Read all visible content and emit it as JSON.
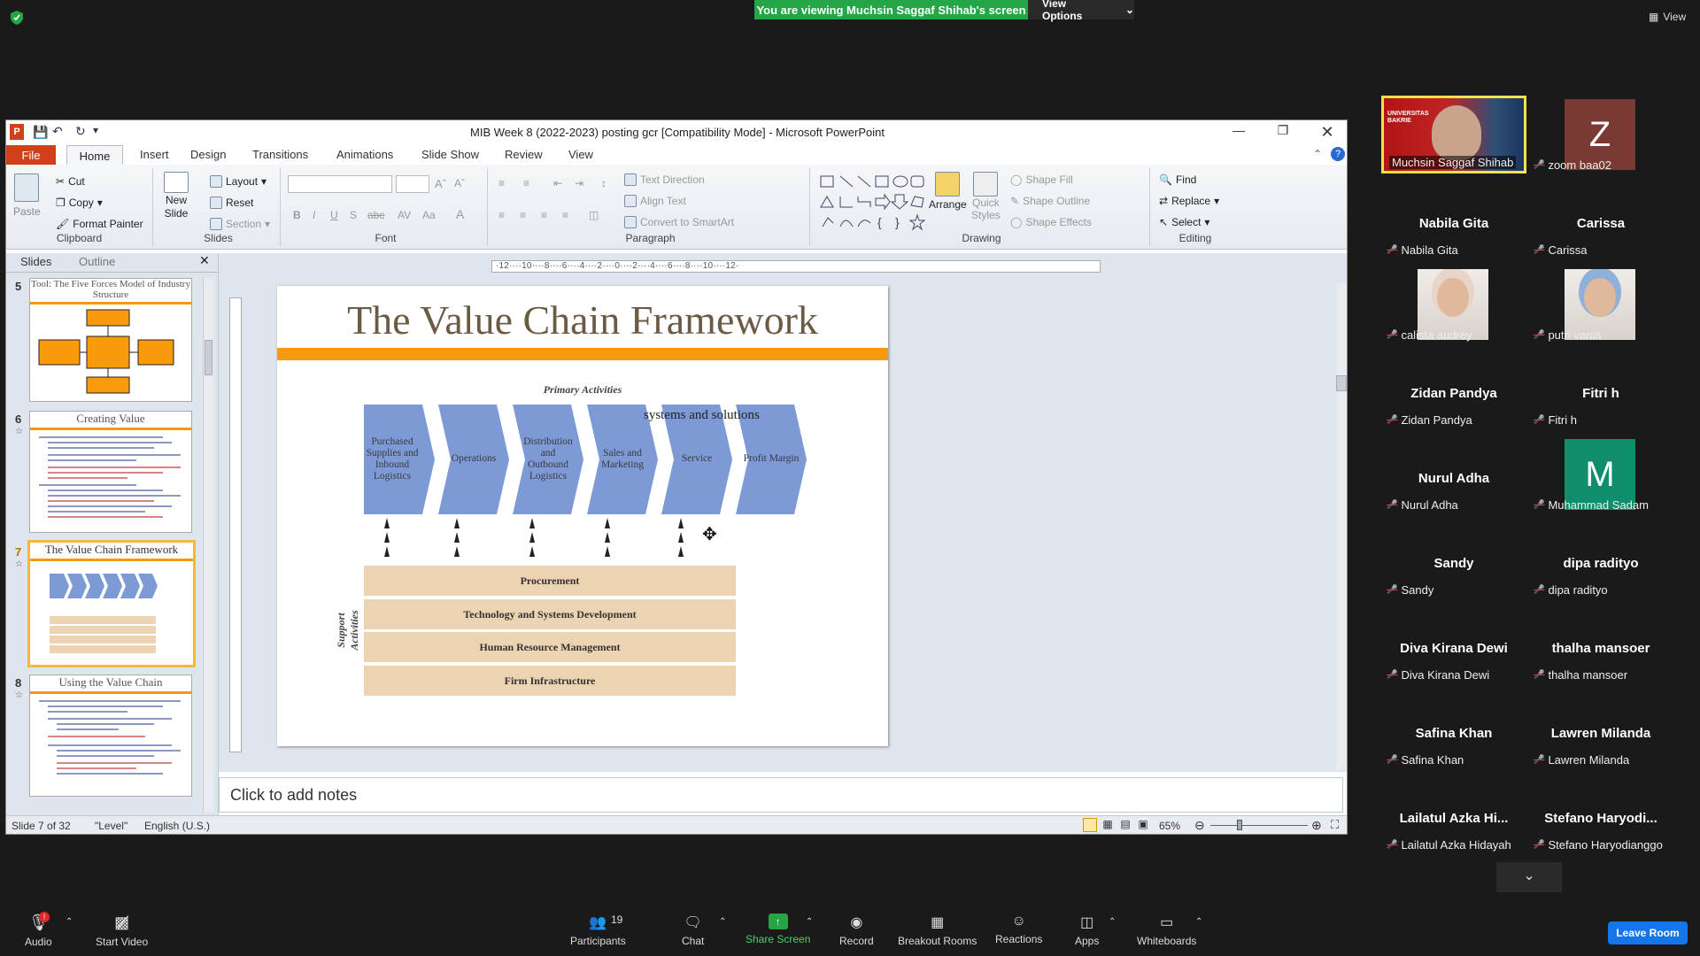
{
  "zoom": {
    "banner": "You are viewing Muchsin Saggaf Shihab's screen",
    "view_options": "View Options",
    "view": "View",
    "toolbar": {
      "audio": "Audio",
      "start_video": "Start Video",
      "participants": "Participants",
      "participants_count": "19",
      "chat": "Chat",
      "share_screen": "Share Screen",
      "record": "Record",
      "breakout": "Breakout Rooms",
      "reactions": "Reactions",
      "apps": "Apps",
      "whiteboards": "Whiteboards",
      "leave": "Leave Room"
    },
    "participants": [
      {
        "display": "",
        "label": "Muchsin Saggaf Shihab",
        "type": "video",
        "photo_caption": "UNIVERSITAS BAKRIE"
      },
      {
        "display": "Z",
        "label": "zoom baa02",
        "type": "avatar",
        "color": "#7a3a34"
      },
      {
        "display": "Nabila Gita",
        "label": "Nabila Gita",
        "type": "name"
      },
      {
        "display": "Carissa",
        "label": "Carissa",
        "type": "name"
      },
      {
        "display": "",
        "label": "calista audrey",
        "type": "photo"
      },
      {
        "display": "",
        "label": "putri vania",
        "type": "photo"
      },
      {
        "display": "Zidan Pandya",
        "label": "Zidan Pandya",
        "type": "name"
      },
      {
        "display": "Fitri h",
        "label": "Fitri h",
        "type": "name"
      },
      {
        "display": "Nurul Adha",
        "label": "Nurul Adha",
        "type": "name"
      },
      {
        "display": "M",
        "label": "Muhammad Sadam",
        "type": "avatar",
        "color": "#0e8e6a"
      },
      {
        "display": "Sandy",
        "label": "Sandy",
        "type": "name"
      },
      {
        "display": "dipa radityo",
        "label": "dipa radityo",
        "type": "name"
      },
      {
        "display": "Diva Kirana Dewi",
        "label": "Diva Kirana Dewi",
        "type": "name"
      },
      {
        "display": "thalha mansoer",
        "label": "thalha mansoer",
        "type": "name"
      },
      {
        "display": "Safina Khan",
        "label": "Safina Khan",
        "type": "name"
      },
      {
        "display": "Lawren Milanda",
        "label": "Lawren Milanda",
        "type": "name"
      },
      {
        "display": "Lailatul  Azka  Hi...",
        "label": "Lailatul Azka Hidayah",
        "type": "name"
      },
      {
        "display": "Stefano  Haryodi...",
        "label": "Stefano Haryodianggo",
        "type": "name"
      }
    ]
  },
  "ppt": {
    "title": "MIB Week 8 (2022-2023) posting gcr [Compatibility Mode]  -  Microsoft PowerPoint",
    "tabs": [
      "File",
      "Home",
      "Insert",
      "Design",
      "Transitions",
      "Animations",
      "Slide Show",
      "Review",
      "View"
    ],
    "ribbon": {
      "paste": "Paste",
      "cut": "Cut",
      "copy": "Copy",
      "format_painter": "Format Painter",
      "clipboard": "Clipboard",
      "new_slide_1": "New",
      "new_slide_2": "Slide",
      "layout": "Layout",
      "reset": "Reset",
      "section": "Section",
      "slides": "Slides",
      "font": "Font",
      "text_direction": "Text Direction",
      "align_text": "Align Text",
      "convert_smartart": "Convert to SmartArt",
      "paragraph": "Paragraph",
      "arrange": "Arrange",
      "quick_styles_1": "Quick",
      "quick_styles_2": "Styles",
      "shape_fill": "Shape Fill",
      "shape_outline": "Shape Outline",
      "shape_effects": "Shape Effects",
      "drawing": "Drawing",
      "find": "Find",
      "replace": "Replace",
      "select": "Select",
      "editing": "Editing"
    },
    "pane_tabs": [
      "Slides",
      "Outline"
    ],
    "thumbnails": [
      {
        "num": "5",
        "title": "Tool: The Five Forces Model of Industry Structure"
      },
      {
        "num": "6",
        "title": "Creating Value"
      },
      {
        "num": "7",
        "title": "The Value Chain Framework"
      },
      {
        "num": "8",
        "title": "Using the Value Chain"
      }
    ],
    "ruler": "·12····10····8····6····4····2····0····2····4····6····8····10····12·",
    "slide": {
      "title": "The Value Chain Framework",
      "primary_activities": "Primary Activities",
      "overlay_text": "systems  and solutions",
      "chevrons": [
        "Purchased Supplies and Inbound Logistics",
        "Operations",
        "Distribution and Outbound Logistics",
        "Sales and Marketing",
        "Service",
        "Profit Margin"
      ],
      "support_label": "Support Activities",
      "support": [
        "Procurement",
        "Technology and Systems Development",
        "Human Resource Management",
        "Firm Infrastructure"
      ]
    },
    "notes_placeholder": "Click to add notes",
    "status": {
      "slide": "Slide 7 of 32",
      "theme": "\"Level\"",
      "language": "English (U.S.)",
      "zoom": "65%"
    }
  }
}
